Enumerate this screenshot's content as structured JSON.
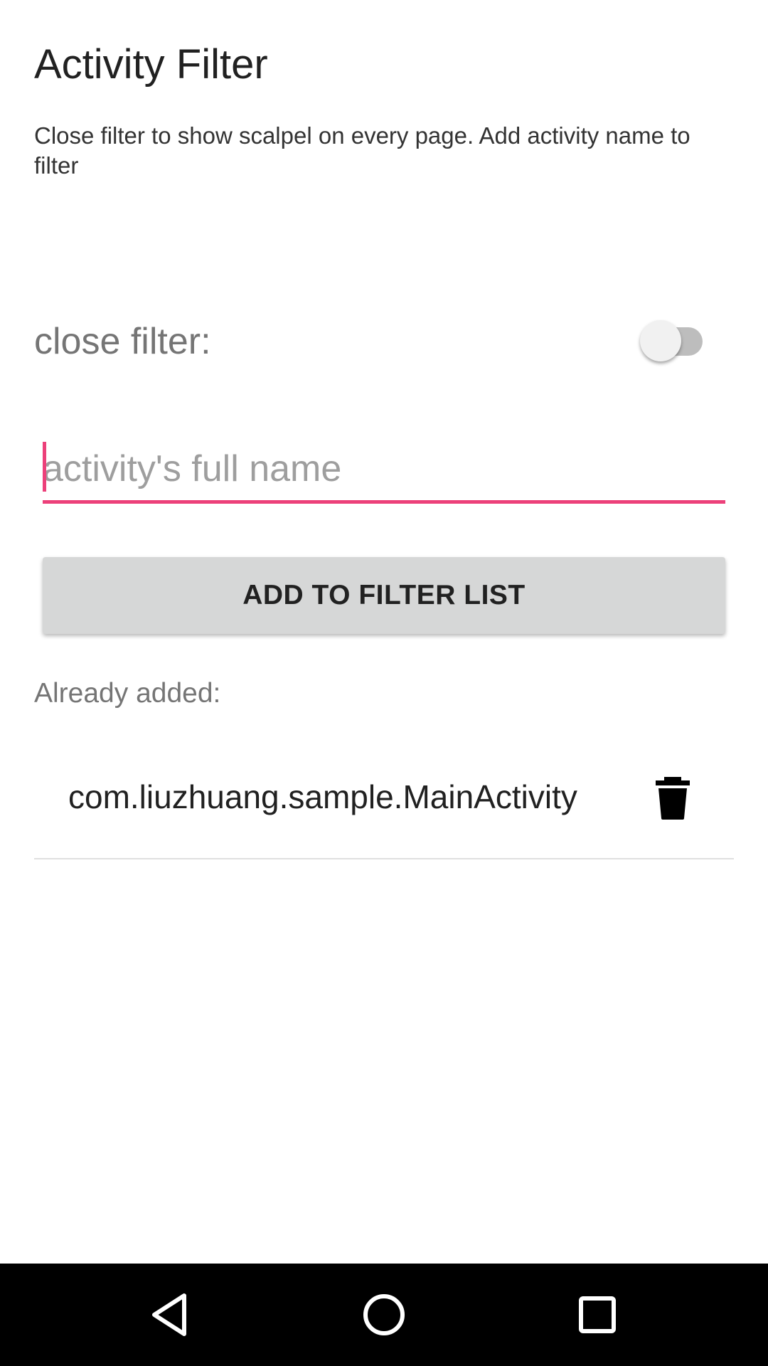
{
  "header": {
    "title": "Activity Filter",
    "description": "Close filter to show scalpel on every page. Add activity name to filter"
  },
  "toggle": {
    "label": "close filter:",
    "checked": false
  },
  "input": {
    "placeholder": "activity's full name",
    "value": ""
  },
  "button": {
    "label": "ADD TO FILTER LIST"
  },
  "list": {
    "label": "Already added:",
    "items": [
      {
        "name": "com.liuzhuang.sample.MainActivity",
        "icon": "trash-icon"
      }
    ]
  },
  "colors": {
    "accent": "#ec407a",
    "button_bg": "#d6d7d7",
    "nav_bar": "#000000"
  },
  "nav": {
    "icons": [
      "back-icon",
      "home-icon",
      "recents-icon"
    ]
  }
}
